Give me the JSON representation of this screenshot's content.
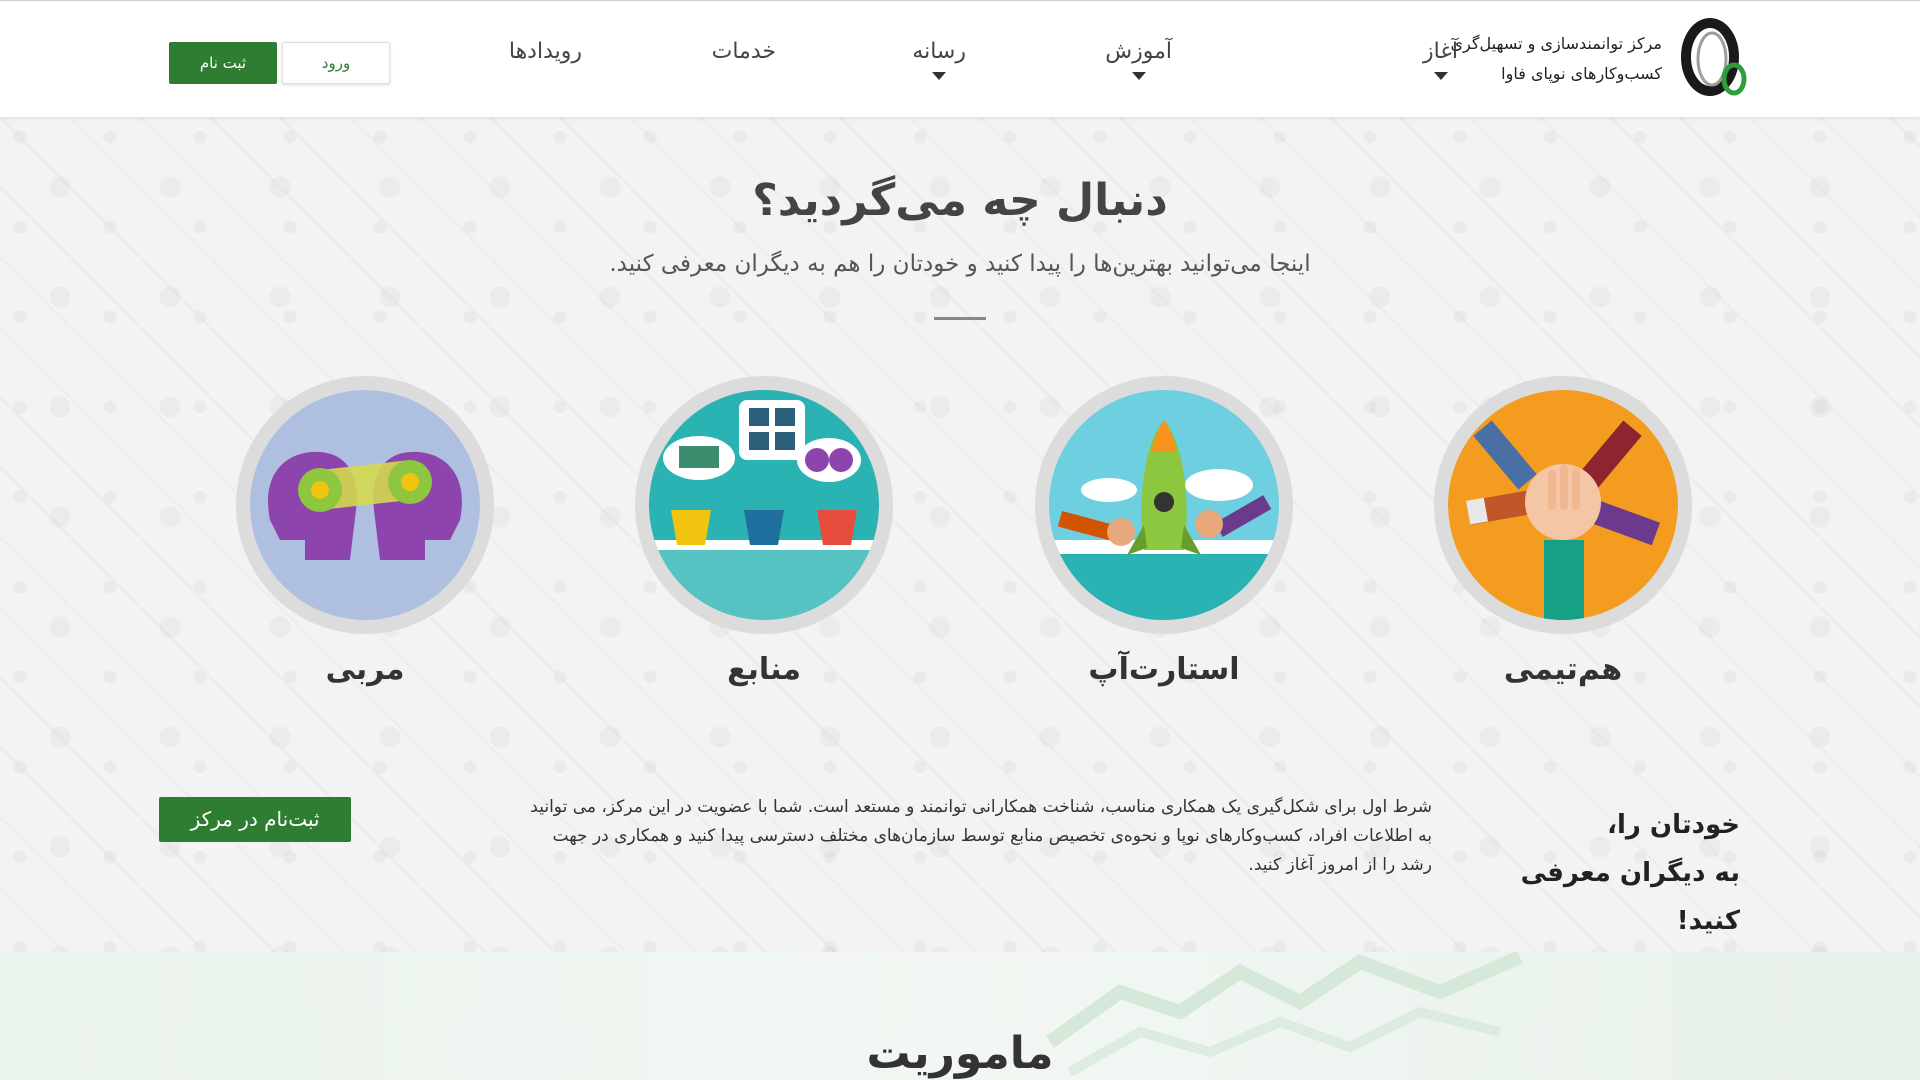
{
  "header": {
    "logo_line1": "مرکز توانمندسازی و تسهیل‌گری",
    "logo_line2": "کسب‌وکارهای نوپای فاوا",
    "nav": [
      {
        "label": "آغاز",
        "has_dropdown": true
      },
      {
        "label": "آموزش",
        "has_dropdown": true
      },
      {
        "label": "رسانه",
        "has_dropdown": true
      },
      {
        "label": "خدمات",
        "has_dropdown": false
      },
      {
        "label": "رویدادها",
        "has_dropdown": false
      }
    ],
    "login_label": "ورود",
    "register_label": "ثبت نام"
  },
  "hero": {
    "title": "دنبال چه می‌گردید؟",
    "subtitle": "اینجا می‌توانید بهترین‌ها را پیدا کنید و خودتان را هم به دیگران معرفی کنید.",
    "cards": [
      {
        "label": "هم‌تیمی",
        "icon": "teamwork-hands-icon"
      },
      {
        "label": "استارت‌آپ",
        "icon": "rocket-icon"
      },
      {
        "label": "منابع",
        "icon": "resources-cups-icon"
      },
      {
        "label": "مربی",
        "icon": "mentor-heads-icon"
      }
    ]
  },
  "intro": {
    "heading_line1": "خودتان را،",
    "heading_line2": "به دیگران معرفی کنید!",
    "text_line1": "شرط اول برای شکل‌گیری یک همکاری مناسب، شناخت همکارانی توانمند و مستعد است. شما با عضویت در این مرکز، می توانید",
    "text_line2": "به اطلاعات افراد، کسب‌وکارهای نوپا و نحوه‌ی تخصیص منابع توسط سازمان‌های مختلف دسترسی پیدا کنید و همکاری در جهت",
    "text_line3": "رشد را از امروز آغاز کنید.",
    "button_label": "ثبت‌نام در مرکز"
  },
  "mission": {
    "title": "ماموریت"
  },
  "colors": {
    "brand_green": "#2e7d32",
    "card_ring": "#dcdcdc"
  }
}
